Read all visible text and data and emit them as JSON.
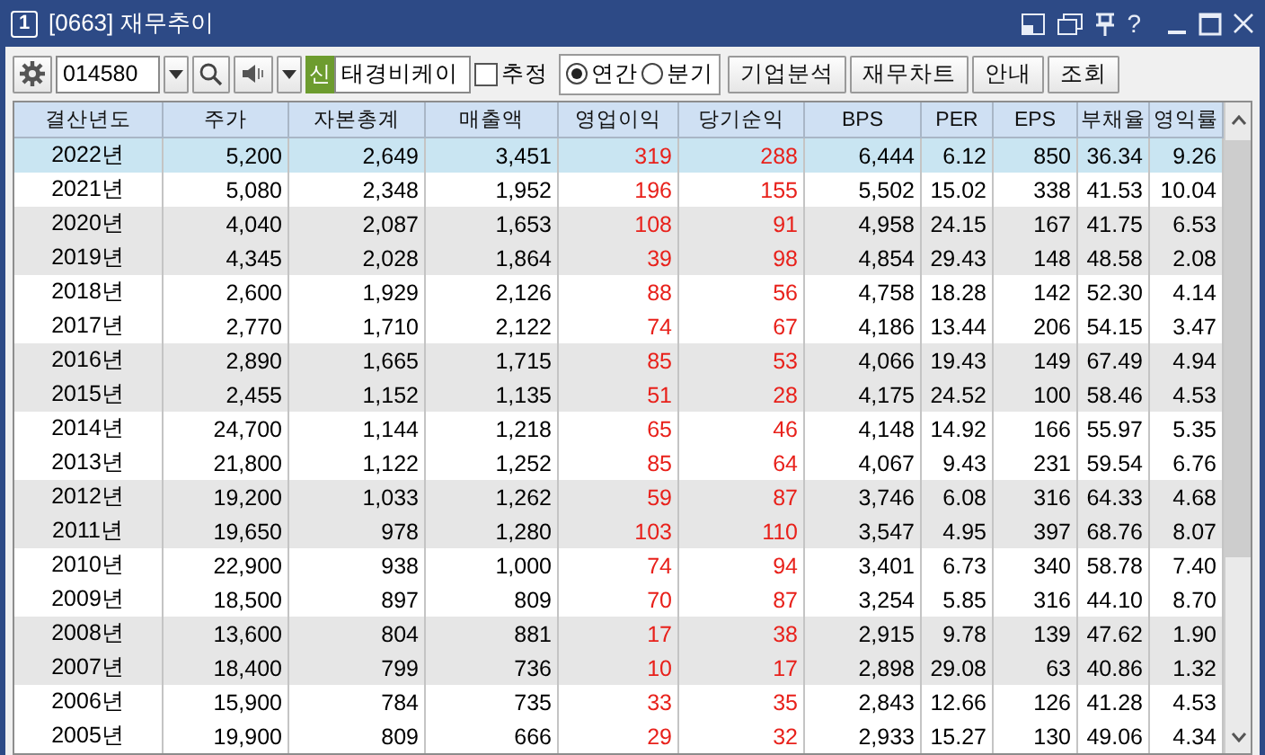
{
  "window": {
    "badge": "1",
    "title": "[0663] 재무추이",
    "help": "?"
  },
  "toolbar": {
    "code": "014580",
    "market_badge": "신",
    "company": "태경비케이",
    "estimate": {
      "label": "추정",
      "checked": false
    },
    "period": [
      {
        "label": "연간",
        "selected": true
      },
      {
        "label": "분기",
        "selected": false
      }
    ],
    "buttons": [
      "기업분석",
      "재무차트",
      "안내",
      "조회"
    ]
  },
  "table": {
    "columns": [
      {
        "label": "결산년도",
        "kind": "year"
      },
      {
        "label": "주가",
        "kind": "number"
      },
      {
        "label": "자본총계",
        "kind": "number"
      },
      {
        "label": "매출액",
        "kind": "number"
      },
      {
        "label": "영업이익",
        "kind": "profit"
      },
      {
        "label": "당기순익",
        "kind": "profit"
      },
      {
        "label": "BPS",
        "kind": "number"
      },
      {
        "label": "PER",
        "kind": "number"
      },
      {
        "label": "EPS",
        "kind": "number"
      },
      {
        "label": "부채율",
        "kind": "number"
      },
      {
        "label": "영익률",
        "kind": "number"
      }
    ],
    "rows": [
      {
        "selected": true,
        "cells": [
          "2022년",
          "5,200",
          "2,649",
          "3,451",
          "319",
          "288",
          "6,444",
          "6.12",
          "850",
          "36.34",
          "9.26"
        ]
      },
      {
        "selected": false,
        "cells": [
          "2021년",
          "5,080",
          "2,348",
          "1,952",
          "196",
          "155",
          "5,502",
          "15.02",
          "338",
          "41.53",
          "10.04"
        ]
      },
      {
        "selected": false,
        "cells": [
          "2020년",
          "4,040",
          "2,087",
          "1,653",
          "108",
          "91",
          "4,958",
          "24.15",
          "167",
          "41.75",
          "6.53"
        ]
      },
      {
        "selected": false,
        "cells": [
          "2019년",
          "4,345",
          "2,028",
          "1,864",
          "39",
          "98",
          "4,854",
          "29.43",
          "148",
          "48.58",
          "2.08"
        ]
      },
      {
        "selected": false,
        "cells": [
          "2018년",
          "2,600",
          "1,929",
          "2,126",
          "88",
          "56",
          "4,758",
          "18.28",
          "142",
          "52.30",
          "4.14"
        ]
      },
      {
        "selected": false,
        "cells": [
          "2017년",
          "2,770",
          "1,710",
          "2,122",
          "74",
          "67",
          "4,186",
          "13.44",
          "206",
          "54.15",
          "3.47"
        ]
      },
      {
        "selected": false,
        "cells": [
          "2016년",
          "2,890",
          "1,665",
          "1,715",
          "85",
          "53",
          "4,066",
          "19.43",
          "149",
          "67.49",
          "4.94"
        ]
      },
      {
        "selected": false,
        "cells": [
          "2015년",
          "2,455",
          "1,152",
          "1,135",
          "51",
          "28",
          "4,175",
          "24.52",
          "100",
          "58.46",
          "4.53"
        ]
      },
      {
        "selected": false,
        "cells": [
          "2014년",
          "24,700",
          "1,144",
          "1,218",
          "65",
          "46",
          "4,148",
          "14.92",
          "166",
          "55.97",
          "5.35"
        ]
      },
      {
        "selected": false,
        "cells": [
          "2013년",
          "21,800",
          "1,122",
          "1,252",
          "85",
          "64",
          "4,067",
          "9.43",
          "231",
          "59.54",
          "6.76"
        ]
      },
      {
        "selected": false,
        "cells": [
          "2012년",
          "19,200",
          "1,033",
          "1,262",
          "59",
          "87",
          "3,746",
          "6.08",
          "316",
          "64.33",
          "4.68"
        ]
      },
      {
        "selected": false,
        "cells": [
          "2011년",
          "19,650",
          "978",
          "1,280",
          "103",
          "110",
          "3,547",
          "4.95",
          "397",
          "68.76",
          "8.07"
        ]
      },
      {
        "selected": false,
        "cells": [
          "2010년",
          "22,900",
          "938",
          "1,000",
          "74",
          "94",
          "3,401",
          "6.73",
          "340",
          "58.78",
          "7.40"
        ]
      },
      {
        "selected": false,
        "cells": [
          "2009년",
          "18,500",
          "897",
          "809",
          "70",
          "87",
          "3,254",
          "5.85",
          "316",
          "44.10",
          "8.70"
        ]
      },
      {
        "selected": false,
        "cells": [
          "2008년",
          "13,600",
          "804",
          "881",
          "17",
          "38",
          "2,915",
          "9.78",
          "139",
          "47.62",
          "1.90"
        ]
      },
      {
        "selected": false,
        "cells": [
          "2007년",
          "18,400",
          "799",
          "736",
          "10",
          "17",
          "2,898",
          "29.08",
          "63",
          "40.86",
          "1.32"
        ]
      },
      {
        "selected": false,
        "cells": [
          "2006년",
          "15,900",
          "784",
          "735",
          "33",
          "35",
          "2,843",
          "12.66",
          "126",
          "41.28",
          "4.53"
        ]
      },
      {
        "selected": false,
        "cells": [
          "2005년",
          "19,900",
          "809",
          "666",
          "29",
          "32",
          "2,933",
          "15.27",
          "130",
          "49.06",
          "4.34"
        ]
      }
    ]
  }
}
